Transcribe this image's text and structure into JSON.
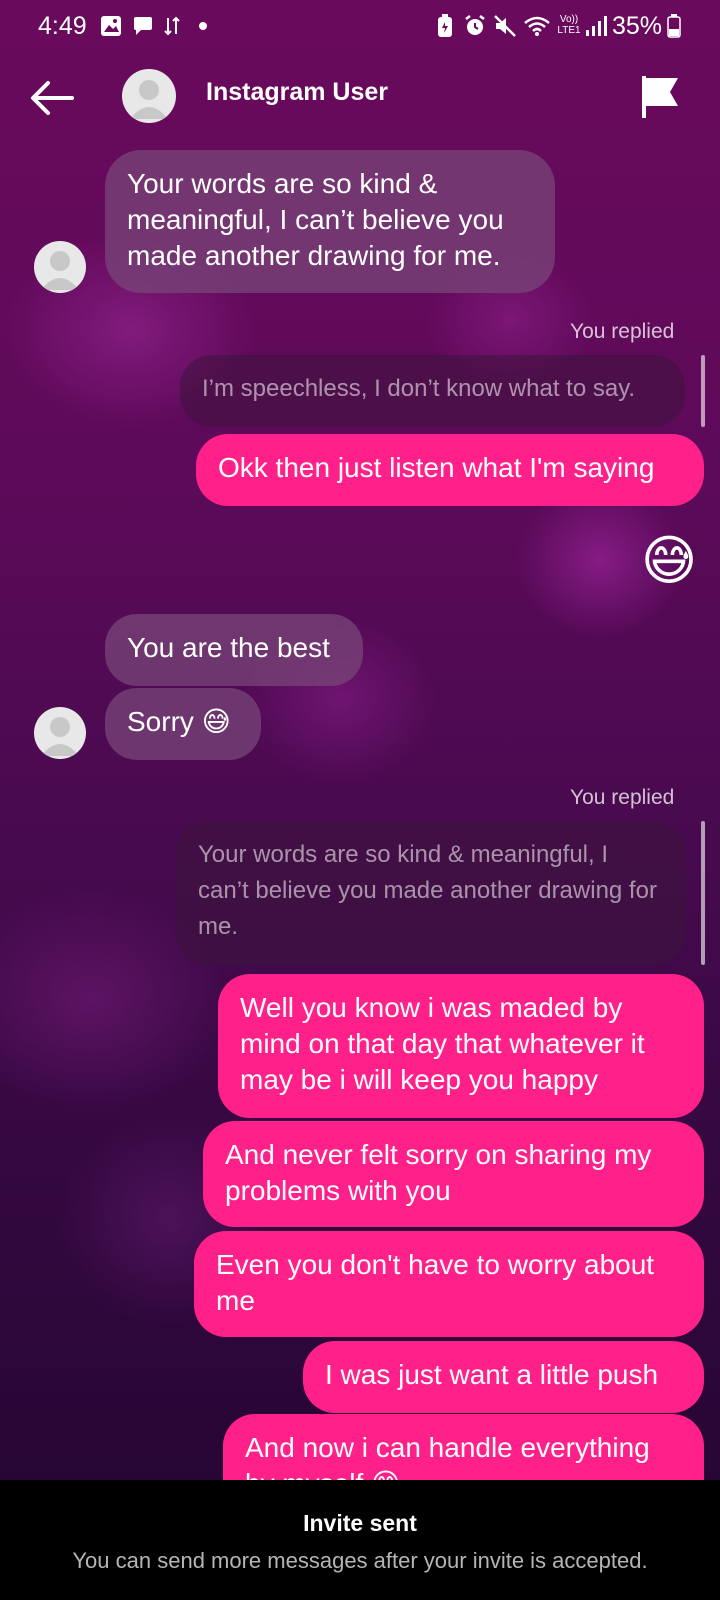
{
  "status_bar": {
    "time": "4:49",
    "battery_percent": "35%",
    "icons": [
      "gallery-icon",
      "chat-icon",
      "data-transfer-icon",
      "dot-icon",
      "battery-saver-icon",
      "alarm-icon",
      "mute-icon",
      "wifi-icon",
      "volte-icon",
      "signal-icon",
      "battery-icon"
    ],
    "volte_label": "Vo)) LTE1"
  },
  "header": {
    "name": "Instagram User"
  },
  "messages": {
    "m1": "Your words are so kind & meaningful, I can’t believe you made another drawing for me.",
    "you_replied_1": "You replied",
    "quote_1": "I’m speechless, I don’t know what to say.",
    "m2": "Okk then just listen what I'm saying",
    "emoji_1": "😅",
    "m3": "You are the best",
    "m4": "Sorry 😅",
    "you_replied_2": "You replied",
    "quote_2": "Your words are so kind & meaningful, I can’t believe you made another drawing for me.",
    "m5": "Well you know i was maded by mind on that day that whatever it may be i will keep you happy",
    "m6": "And never felt sorry on sharing my problems with you",
    "m7": "Even you don't have to worry about me",
    "m8": "I was just want a little push",
    "m9": "And now i can handle everything by myself 😊"
  },
  "footer": {
    "title": "Invite sent",
    "subtitle": "You can send more messages after your invite is accepted."
  },
  "colors": {
    "outgoing_bubble": "#ff2189",
    "incoming_bubble": "#7a467a",
    "footer_bg": "#000000"
  }
}
